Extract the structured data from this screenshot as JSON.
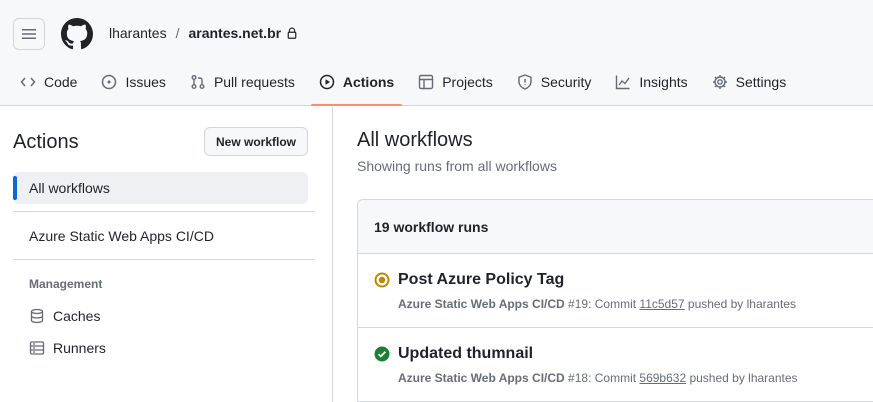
{
  "header": {
    "owner": "lharantes",
    "separator": "/",
    "repo": "arantes.net.br"
  },
  "tabs": [
    {
      "label": "Code",
      "icon": "code-icon"
    },
    {
      "label": "Issues",
      "icon": "issue-opened-icon"
    },
    {
      "label": "Pull requests",
      "icon": "git-pull-request-icon"
    },
    {
      "label": "Actions",
      "icon": "play-icon",
      "active": true
    },
    {
      "label": "Projects",
      "icon": "table-icon"
    },
    {
      "label": "Security",
      "icon": "shield-icon"
    },
    {
      "label": "Insights",
      "icon": "graph-icon"
    },
    {
      "label": "Settings",
      "icon": "gear-icon"
    }
  ],
  "sidebar": {
    "title": "Actions",
    "new_workflow": "New workflow",
    "all_workflows": "All workflows",
    "workflows": [
      "Azure Static Web Apps CI/CD"
    ],
    "management_label": "Management",
    "management": [
      {
        "label": "Caches",
        "icon": "database-icon"
      },
      {
        "label": "Runners",
        "icon": "server-icon"
      }
    ]
  },
  "main": {
    "title": "All workflows",
    "subtitle": "Showing runs from all workflows",
    "runs_count_label": "19 workflow runs",
    "runs": [
      {
        "title": "Post Azure Policy Tag",
        "status": "in-progress",
        "workflow": "Azure Static Web Apps CI/CD",
        "number": "#19",
        "commit_prefix": ": Commit ",
        "sha": "11c5d57",
        "pushed_by": " pushed by lharantes"
      },
      {
        "title": "Updated thumnail",
        "status": "success",
        "workflow": "Azure Static Web Apps CI/CD",
        "number": "#18",
        "commit_prefix": ": Commit ",
        "sha": "569b632",
        "pushed_by": " pushed by lharantes"
      }
    ]
  },
  "colors": {
    "accent_tab": "#fd8c73",
    "active_bar": "#0969da",
    "in_progress": "#bf8700",
    "success": "#1a7f37"
  }
}
